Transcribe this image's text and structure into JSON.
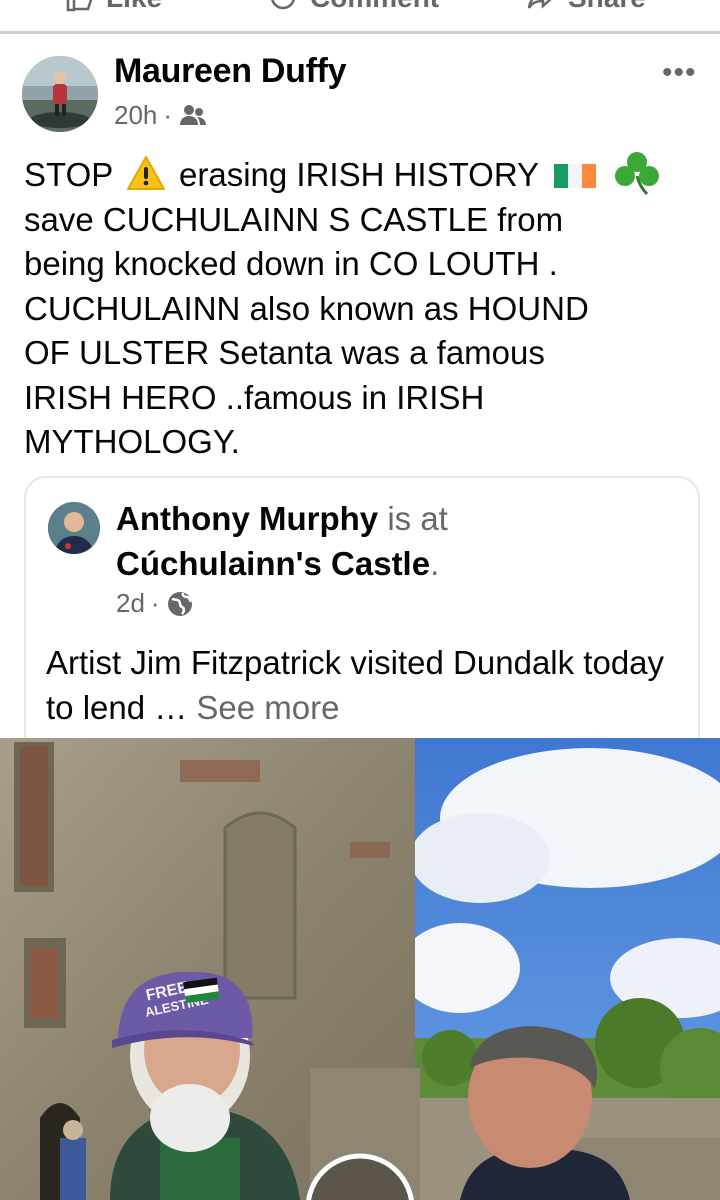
{
  "actions": {
    "like": "Like",
    "comment": "Comment",
    "share": "Share"
  },
  "post": {
    "author": "Maureen Duffy",
    "time": "20h",
    "separator": "·",
    "audience_icon": "friends-icon",
    "more_label": "•••",
    "text_lines": [
      "STOP",
      "erasing IRISH HISTORY",
      "save CUCHULAINN S CASTLE from",
      "being knocked down in CO LOUTH .",
      "CUCHULAINN also known as HOUND",
      "OF ULSTER Setanta was a famous",
      "IRISH HERO ..famous in IRISH",
      "MYTHOLOGY."
    ],
    "emoji": {
      "warning": "⚠",
      "shamrock": "☘"
    },
    "flag_colors": [
      "#169b62",
      "#ffffff",
      "#ff883e"
    ]
  },
  "shared": {
    "author": "Anthony Murphy",
    "is_at": "is at",
    "place": "Cúchulainn's Castle",
    "period": ".",
    "time": "2d",
    "separator": "·",
    "audience_icon": "globe-icon",
    "text": "Artist Jim Fitzpatrick visited Dundalk today to lend …",
    "see_more": "See more",
    "hat_text_1": "FREE",
    "hat_text_2": "ALESTINE"
  },
  "colors": {
    "secondary_text": "#65676b",
    "border": "#e4e6eb",
    "sky": "#4a82d8"
  }
}
